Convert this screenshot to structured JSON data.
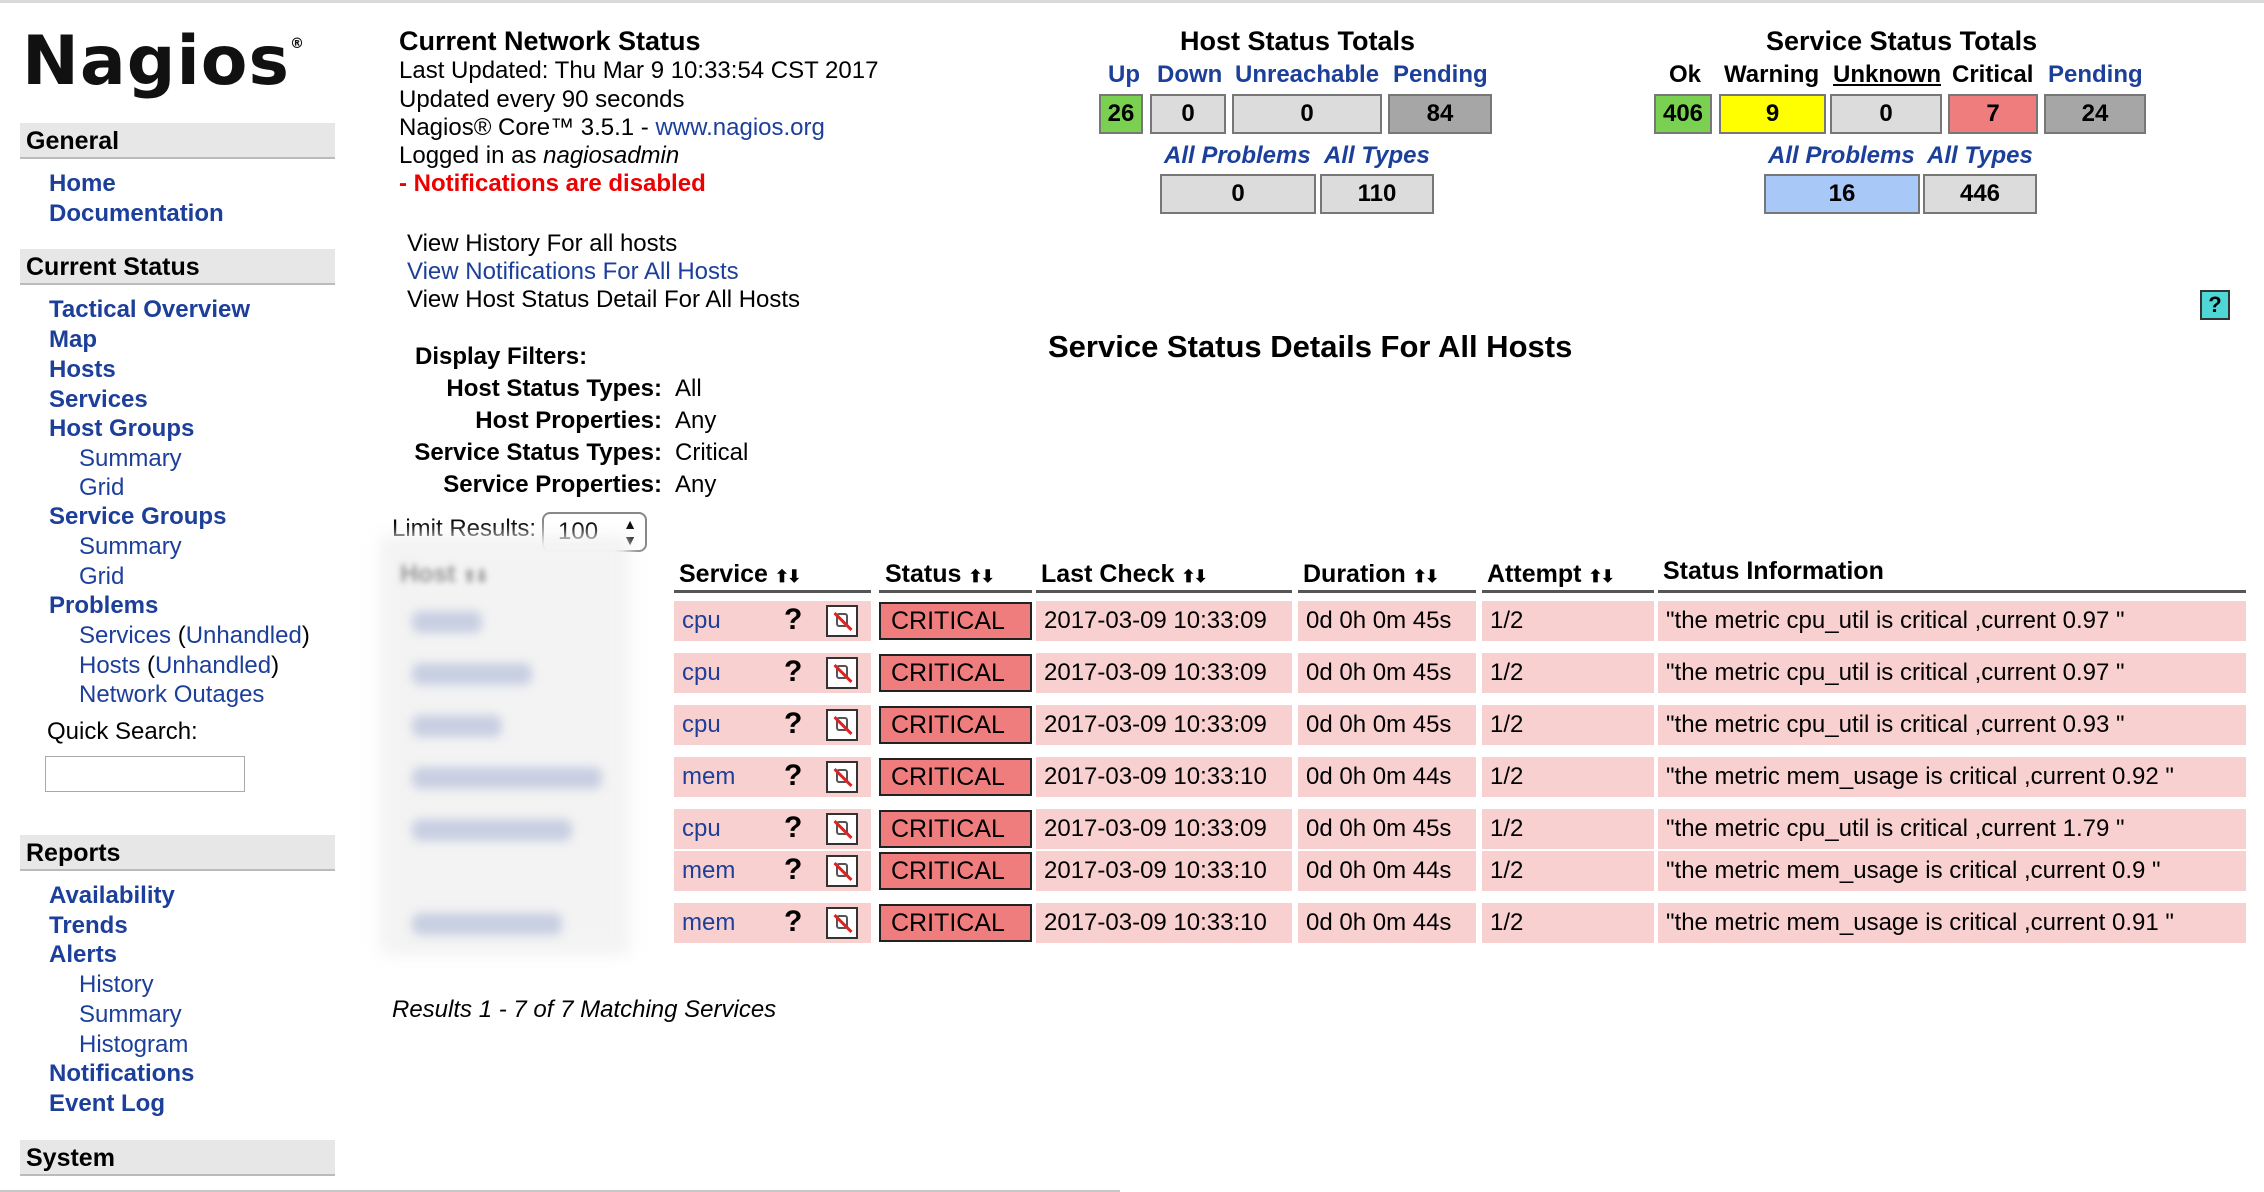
{
  "logo": {
    "name": "Nagios",
    "mark": "®"
  },
  "sidebar": {
    "general": {
      "title": "General",
      "items": [
        "Home",
        "Documentation"
      ]
    },
    "current_status": {
      "title": "Current Status",
      "items": [
        "Tactical Overview",
        "Map",
        "Hosts",
        "Services",
        "Host Groups",
        "Summary",
        "Grid",
        "Service Groups",
        "Summary",
        "Grid",
        "Problems"
      ],
      "problems_services": "Services",
      "problems_services_unhandled": "Unhandled",
      "problems_hosts": "Hosts",
      "problems_hosts_unhandled": "Unhandled",
      "network_outages": "Network Outages",
      "quick_search_label": "Quick Search:"
    },
    "reports": {
      "title": "Reports",
      "items": [
        "Availability",
        "Trends",
        "Alerts",
        "History",
        "Summary",
        "Histogram",
        "Notifications",
        "Event Log"
      ]
    },
    "system": {
      "title": "System"
    }
  },
  "status_info": {
    "title": "Current Network Status",
    "last_updated": "Last Updated: Thu Mar 9 10:33:54 CST 2017",
    "update_interval": "Updated every 90 seconds",
    "core_version": "Nagios® Core™ 3.5.1 - ",
    "core_link": "www.nagios.org",
    "logged_in_prefix": "Logged in as ",
    "logged_in_user": "nagiosadmin",
    "notifications_warning": "- Notifications are disabled"
  },
  "view_links": [
    "View History For all hosts",
    "View Notifications For All Hosts",
    "View Host Status Detail For All Hosts"
  ],
  "host_totals": {
    "title": "Host Status Totals",
    "labels": [
      "Up",
      "Down",
      "Unreachable",
      "Pending"
    ],
    "values": [
      "26",
      "0",
      "0",
      "84"
    ],
    "sub_labels": [
      "All Problems",
      "All Types"
    ],
    "sub_values": [
      "0",
      "110"
    ]
  },
  "service_totals": {
    "title": "Service Status Totals",
    "labels": [
      "Ok",
      "Warning",
      "Unknown",
      "Critical",
      "Pending"
    ],
    "values": [
      "406",
      "9",
      "0",
      "7",
      "24"
    ],
    "sub_labels": [
      "All Problems",
      "All Types"
    ],
    "sub_values": [
      "16",
      "446"
    ]
  },
  "help_icon": "?",
  "page_title": "Service Status Details For All Hosts",
  "filters": {
    "title": "Display Filters:",
    "rows": [
      {
        "key": "Host Status Types:",
        "value": "All"
      },
      {
        "key": "Host Properties:",
        "value": "Any"
      },
      {
        "key": "Service Status Types:",
        "value": "Critical"
      },
      {
        "key": "Service Properties:",
        "value": "Any"
      }
    ]
  },
  "limit": {
    "label": "Limit Results:",
    "value": "100"
  },
  "table": {
    "headers": {
      "host": "Host",
      "service": "Service",
      "status": "Status",
      "last_check": "Last Check",
      "duration": "Duration",
      "attempt": "Attempt",
      "info": "Status Information"
    },
    "rows": [
      {
        "service": "cpu",
        "status": "CRITICAL",
        "last_check": "2017-03-09 10:33:09",
        "duration": "0d 0h 0m 45s",
        "attempt": "1/2",
        "info": "\"the metric cpu_util is critical ,current 0.97 \""
      },
      {
        "service": "cpu",
        "status": "CRITICAL",
        "last_check": "2017-03-09 10:33:09",
        "duration": "0d 0h 0m 45s",
        "attempt": "1/2",
        "info": "\"the metric cpu_util is critical ,current 0.97 \""
      },
      {
        "service": "cpu",
        "status": "CRITICAL",
        "last_check": "2017-03-09 10:33:09",
        "duration": "0d 0h 0m 45s",
        "attempt": "1/2",
        "info": "\"the metric cpu_util is critical ,current 0.93 \""
      },
      {
        "service": "mem",
        "status": "CRITICAL",
        "last_check": "2017-03-09 10:33:10",
        "duration": "0d 0h 0m 44s",
        "attempt": "1/2",
        "info": "\"the metric mem_usage is critical ,current 0.92 \""
      },
      {
        "service": "cpu",
        "status": "CRITICAL",
        "last_check": "2017-03-09 10:33:09",
        "duration": "0d 0h 0m 45s",
        "attempt": "1/2",
        "info": "\"the metric cpu_util is critical ,current 1.79 \""
      },
      {
        "service": "mem",
        "status": "CRITICAL",
        "last_check": "2017-03-09 10:33:10",
        "duration": "0d 0h 0m 44s",
        "attempt": "1/2",
        "info": "\"the metric mem_usage is critical ,current 0.9 \""
      },
      {
        "service": "mem",
        "status": "CRITICAL",
        "last_check": "2017-03-09 10:33:10",
        "duration": "0d 0h 0m 44s",
        "attempt": "1/2",
        "info": "\"the metric mem_usage is critical ,current 0.91 \""
      }
    ]
  },
  "results_text": "Results 1 - 7 of 7 Matching Services"
}
